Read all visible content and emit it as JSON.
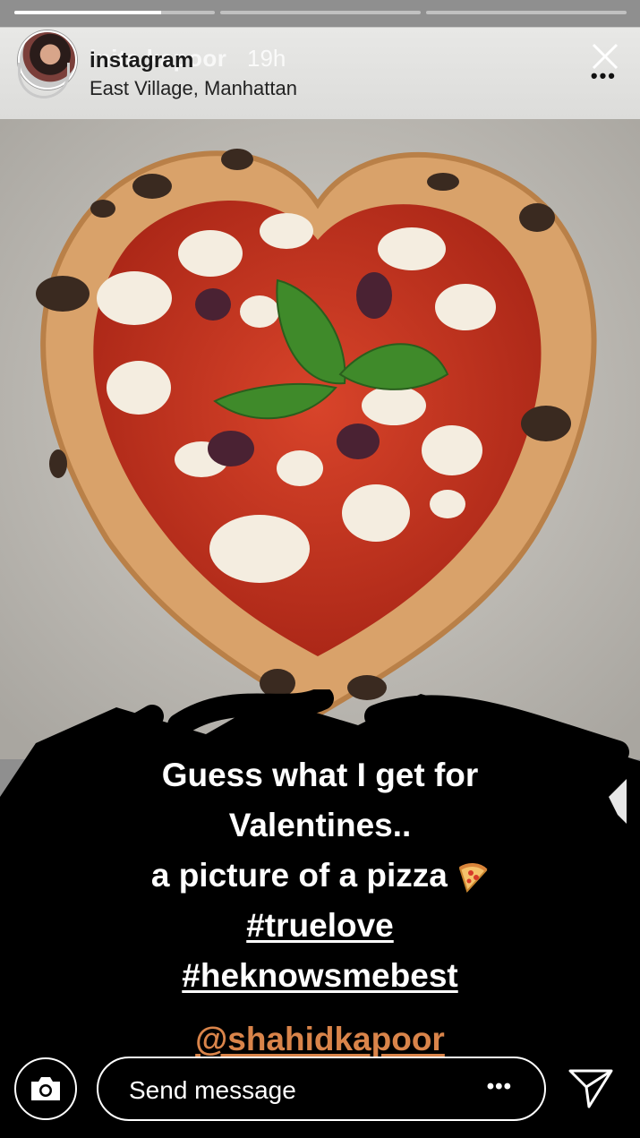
{
  "story": {
    "progress": [
      0.73,
      0,
      0
    ],
    "username": "inita kapoor",
    "username_overlay": "instagram",
    "time": "19h",
    "location": "East Village, Manhattan"
  },
  "caption": {
    "line1": "Guess what I get for",
    "line2": "Valentines..",
    "line3": "a picture of a pizza",
    "hashtag1": "#truelove",
    "hashtag2": "#heknowsmebest",
    "mention": "@shahidkapoor"
  },
  "footer": {
    "placeholder": "Send message",
    "more": "•••"
  },
  "icons": {
    "close": "close-icon",
    "more": "more-icon",
    "camera": "camera-icon",
    "share": "send-icon",
    "pizza": "pizza-emoji"
  }
}
